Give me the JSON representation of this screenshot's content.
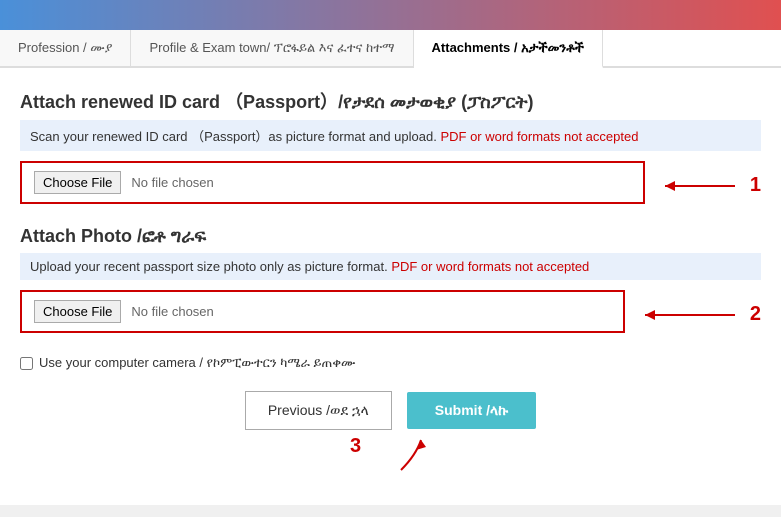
{
  "topBanner": {},
  "tabs": [
    {
      "id": "profession",
      "label": "Profession / ሙያ",
      "active": false
    },
    {
      "id": "profile",
      "label": "Profile & Exam town/ ፕሮፋይል እና ፈተና ከተማ",
      "active": false
    },
    {
      "id": "attachments",
      "label": "Attachments / አታችመንቶች",
      "active": true
    }
  ],
  "sections": [
    {
      "id": "id-card",
      "title": "Attach renewed ID card （Passport）/የታደሰ መታወቂያ (ፓስፖርት)",
      "description": "Scan your renewed ID card （Passport）as picture format and upload.",
      "descriptionWarn": "PDF or word formats not accepted",
      "fileLabel": "Choose File",
      "noFileText": "No file chosen",
      "arrowNum": "1"
    },
    {
      "id": "photo",
      "title": "Attach Photo /ፎቶ ግራፍ",
      "description": "Upload your recent passport size photo only as picture format.",
      "descriptionWarn": "PDF or word formats not accepted",
      "fileLabel": "Choose File",
      "noFileText": "No file chosen",
      "arrowNum": "2"
    }
  ],
  "checkbox": {
    "label": "Use your computer camera / የኮምፒውተርን ካሜራ ይጠቀሙ"
  },
  "buttons": {
    "previous": "Previous /ወደ ኋላ",
    "submit": "Submit /ላኩ"
  },
  "bottomAnnotationNum": "3"
}
